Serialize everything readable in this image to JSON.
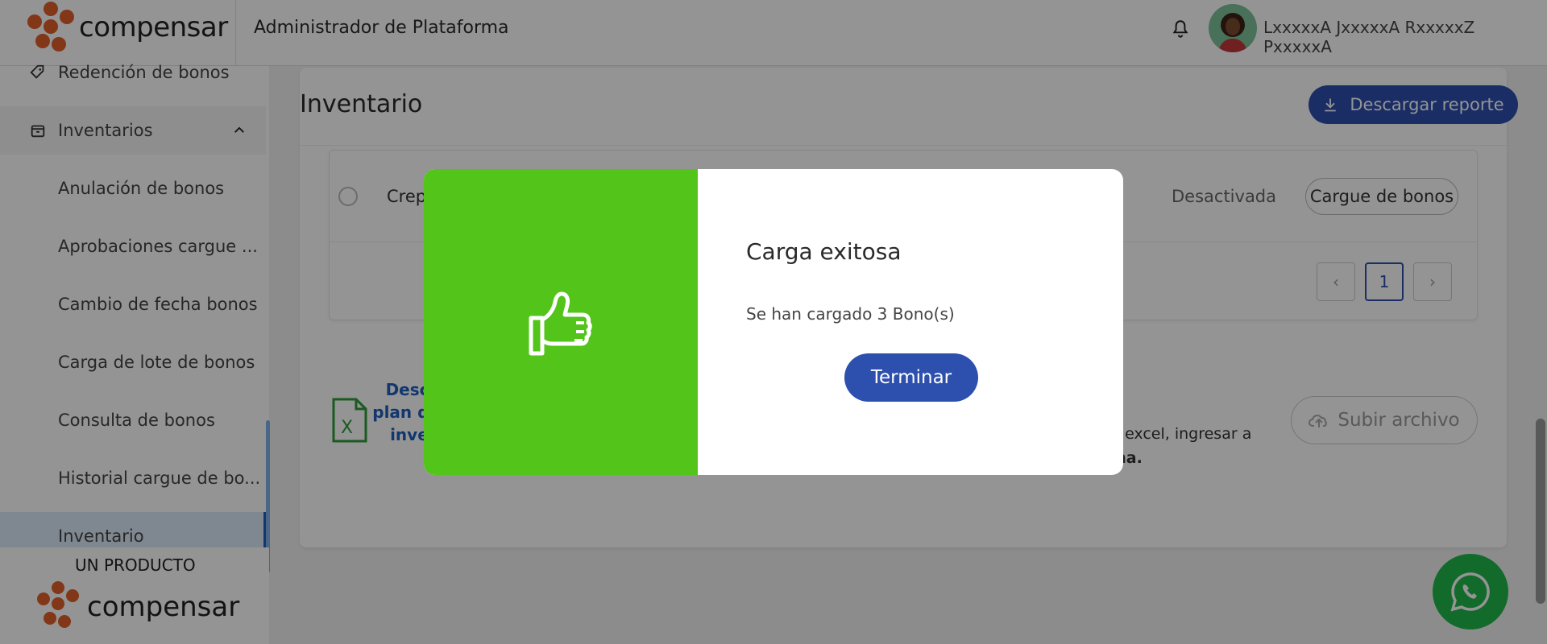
{
  "header": {
    "brand": "compensar",
    "title": "Administrador de Plataforma",
    "username": "LxxxxxA JxxxxxA RxxxxxZ PxxxxxA"
  },
  "sidebar": {
    "items": [
      {
        "label": "Redención de bonos",
        "icon": "tag-icon"
      },
      {
        "label": "Inventarios",
        "icon": "box-icon"
      },
      {
        "label": "Anulación de bonos"
      },
      {
        "label": "Aprobaciones cargue ..."
      },
      {
        "label": "Cambio de fecha bonos"
      },
      {
        "label": "Carga de lote de bonos"
      },
      {
        "label": "Consulta de bonos"
      },
      {
        "label": "Historial cargue de bo..."
      },
      {
        "label": "Inventario"
      }
    ],
    "footer_label": "UN PRODUCTO",
    "footer_brand": "compensar"
  },
  "main": {
    "title": "Inventario",
    "download_label": "Descargar reporte",
    "row": {
      "name": "Crep",
      "status": "Desactivada",
      "action": "Cargue de bonos"
    },
    "pager": {
      "prev": "‹",
      "current": "1",
      "next": "›"
    },
    "template_link": "Desca plan de inven",
    "instructions_line1": "n excel, ingresar a",
    "instructions_line2": "ma.",
    "upload_label": "Subir archivo"
  },
  "modal": {
    "title": "Carga exitosa",
    "message": "Se han cargado 3 Bono(s)",
    "button": "Terminar"
  },
  "colors": {
    "primary": "#2d4fae",
    "success": "#52c41a",
    "brand_orange": "#e0602a",
    "whatsapp": "#20b84a"
  }
}
